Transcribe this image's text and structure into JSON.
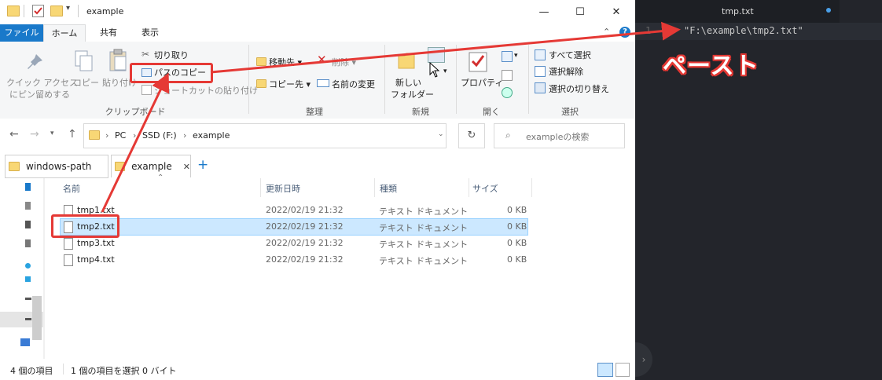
{
  "window": {
    "title": "example"
  },
  "ribbon_tabs": [
    {
      "label": "ファイル",
      "active": false
    },
    {
      "label": "ホーム",
      "active": true
    },
    {
      "label": "共有",
      "active": false
    },
    {
      "label": "表示",
      "active": false
    }
  ],
  "ribbon": {
    "pin_quick_access": "クイック アクセス",
    "pin_quick_access2": "にピン留めする",
    "copy": "コピー",
    "paste": "貼り付け",
    "cut": "切り取り",
    "copy_path": "パスのコピー",
    "paste_shortcut": "ショートカットの貼り付け",
    "move_to": "移動先",
    "copy_to": "コピー先",
    "delete": "削除",
    "rename": "名前の変更",
    "new_folder": "新しい",
    "new_folder2": "フォルダー",
    "properties": "プロパティ",
    "select_all": "すべて選択",
    "select_none": "選択解除",
    "invert_selection": "選択の切り替え",
    "groups": {
      "clipboard": "クリップボード",
      "organize": "整理",
      "new": "新規",
      "open": "開く",
      "select": "選択"
    }
  },
  "address": {
    "crumbs": [
      "PC",
      "SSD (F:)",
      "example"
    ],
    "search_placeholder": "exampleの検索"
  },
  "folder_tabs": [
    {
      "label": "windows-path"
    },
    {
      "label": "example"
    }
  ],
  "columns": {
    "name": "名前",
    "modified": "更新日時",
    "type": "種類",
    "size": "サイズ"
  },
  "files": [
    {
      "name": "tmp1.txt",
      "modified": "2022/02/19 21:32",
      "type": "テキスト ドキュメント",
      "size": "0 KB"
    },
    {
      "name": "tmp2.txt",
      "modified": "2022/02/19 21:32",
      "type": "テキスト ドキュメント",
      "size": "0 KB"
    },
    {
      "name": "tmp3.txt",
      "modified": "2022/02/19 21:32",
      "type": "テキスト ドキュメント",
      "size": "0 KB"
    },
    {
      "name": "tmp4.txt",
      "modified": "2022/02/19 21:32",
      "type": "テキスト ドキュメント",
      "size": "0 KB"
    }
  ],
  "status": {
    "item_count": "4 個の項目",
    "selected": "1 個の項目を選択 0 バイト"
  },
  "editor": {
    "tab_title": "tmp.txt",
    "line_number": "1",
    "line_text": "\"F:\\example\\tmp2.txt\""
  },
  "annotation": {
    "paste_label": "ペースト"
  },
  "colors": {
    "accent": "#1979ca",
    "annotation_red": "#e53935",
    "selection": "#cce8ff",
    "editor_bg": "#23252b"
  }
}
